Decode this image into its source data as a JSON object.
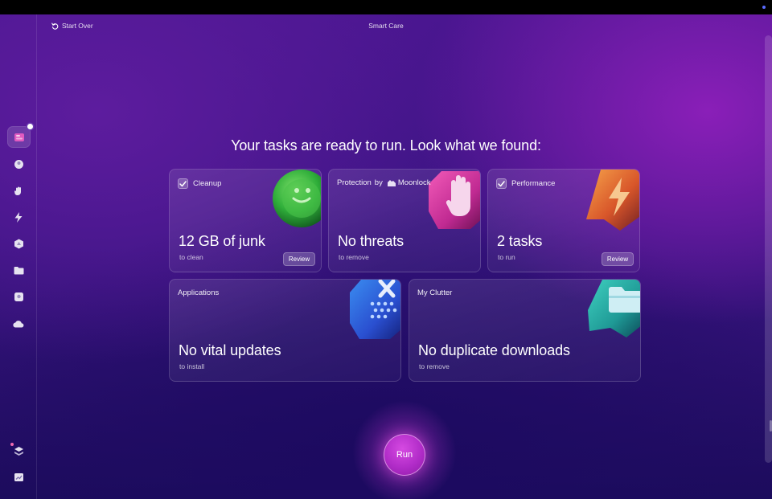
{
  "window": {
    "title": "Smart Care"
  },
  "header": {
    "start_over_label": "Start Over"
  },
  "headline": "Your tasks are ready to run. Look what we found:",
  "sidebar": {
    "items": [
      {
        "icon": "smart-care-icon",
        "active": true
      },
      {
        "icon": "cleanup-icon"
      },
      {
        "icon": "protection-hand-icon"
      },
      {
        "icon": "performance-bolt-icon"
      },
      {
        "icon": "applications-icon"
      },
      {
        "icon": "files-folder-icon"
      },
      {
        "icon": "clutter-icon"
      },
      {
        "icon": "cloud-icon"
      },
      {
        "icon": "assistant-stack-icon"
      },
      {
        "icon": "monitor-chart-icon"
      }
    ]
  },
  "cards": {
    "cleanup": {
      "label": "Cleanup",
      "checked": true,
      "value": "12 GB of junk",
      "sub": "to clean",
      "button": "Review"
    },
    "protection": {
      "label": "Protection",
      "by": "by",
      "vendor": "Moonlock",
      "value": "No threats",
      "sub": "to remove"
    },
    "performance": {
      "label": "Performance",
      "checked": true,
      "value": "2 tasks",
      "sub": "to run",
      "button": "Review"
    },
    "applications": {
      "label": "Applications",
      "value": "No vital updates",
      "sub": "to install"
    },
    "clutter": {
      "label": "My Clutter",
      "value": "No duplicate downloads",
      "sub": "to remove"
    }
  },
  "run_button": {
    "label": "Run"
  },
  "colors": {
    "accent": "#b12cc8",
    "cleanup_art": "#2fae3a",
    "protection_art": "#d0329e",
    "performance_art": "#e0702a",
    "applications_art": "#2c5fd8",
    "clutter_art": "#23a29a"
  }
}
